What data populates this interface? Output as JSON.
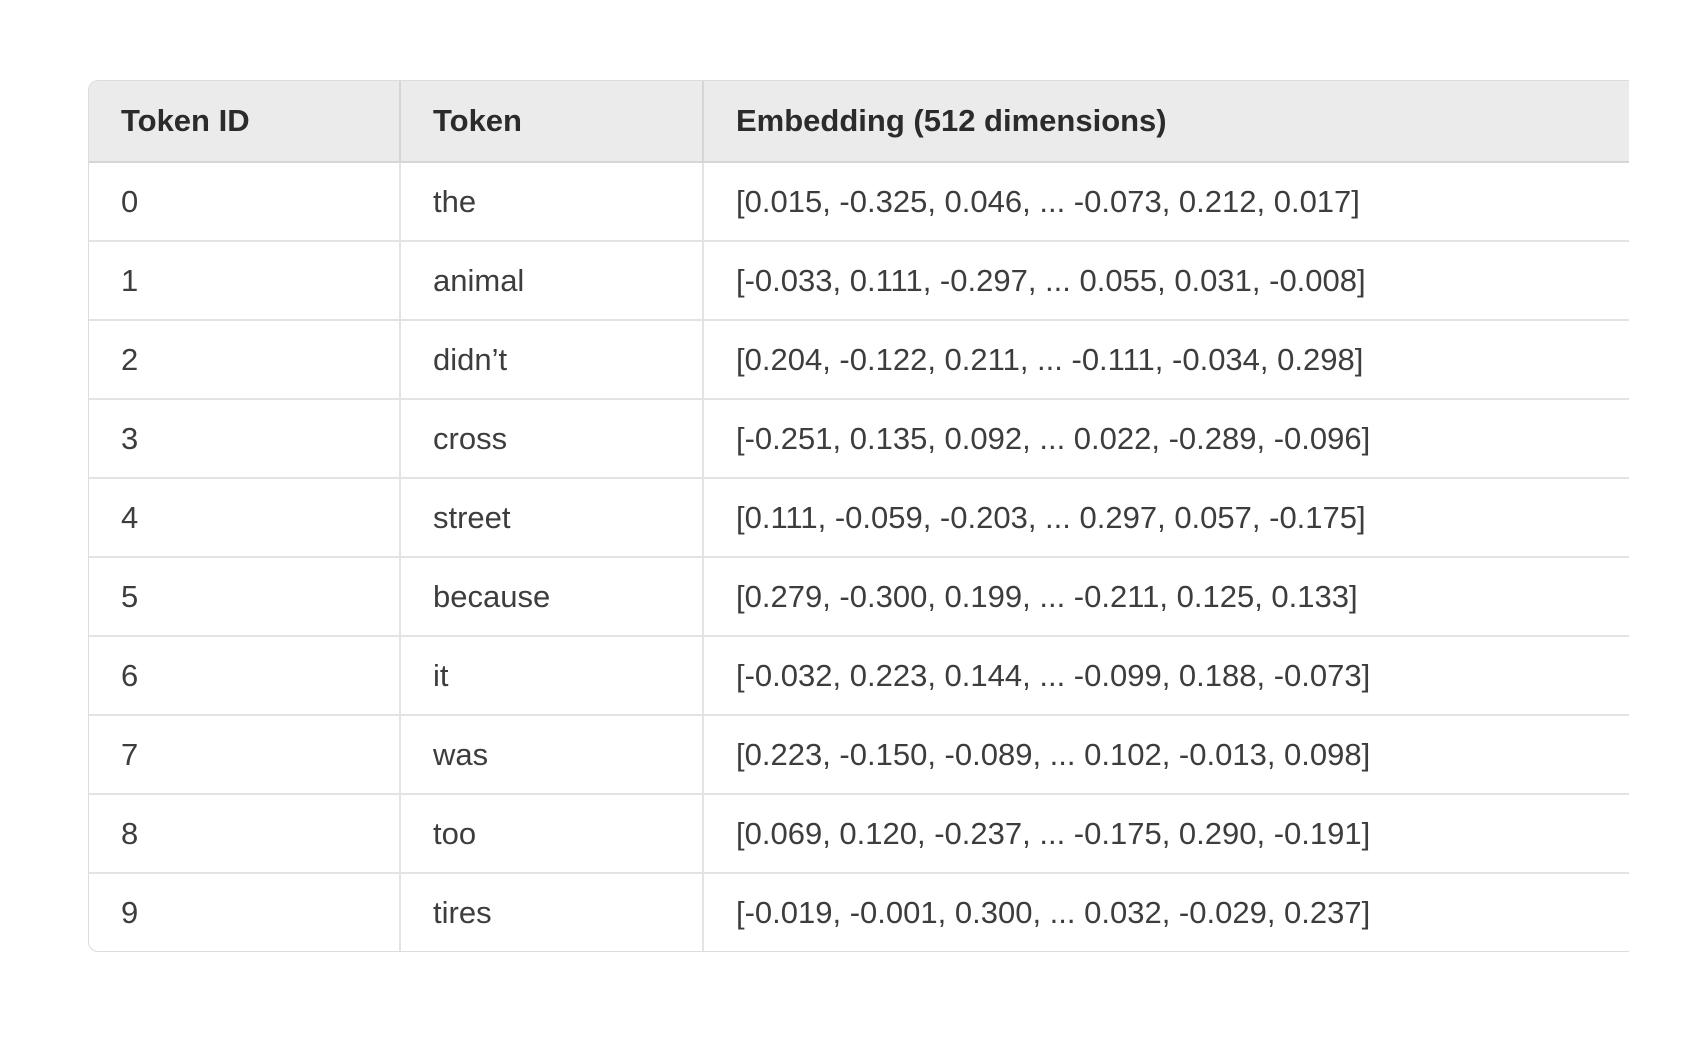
{
  "table": {
    "headers": [
      "Token ID",
      "Token",
      "Embedding (512 dimensions)"
    ],
    "rows": [
      {
        "id": "0",
        "token": "the",
        "embedding": "[0.015, -0.325, 0.046, ... -0.073, 0.212, 0.017]"
      },
      {
        "id": "1",
        "token": "animal",
        "embedding": "[-0.033, 0.111, -0.297, ... 0.055, 0.031, -0.008]"
      },
      {
        "id": "2",
        "token": "didn’t",
        "embedding": "[0.204, -0.122, 0.211, ... -0.111, -0.034, 0.298]"
      },
      {
        "id": "3",
        "token": "cross",
        "embedding": "[-0.251, 0.135, 0.092, ... 0.022, -0.289, -0.096]"
      },
      {
        "id": "4",
        "token": "street",
        "embedding": "[0.111, -0.059, -0.203, ... 0.297, 0.057, -0.175]"
      },
      {
        "id": "5",
        "token": "because",
        "embedding": "[0.279, -0.300, 0.199, ... -0.211, 0.125, 0.133]"
      },
      {
        "id": "6",
        "token": "it",
        "embedding": "[-0.032, 0.223, 0.144, ... -0.099, 0.188, -0.073]"
      },
      {
        "id": "7",
        "token": "was",
        "embedding": "[0.223, -0.150, -0.089, ... 0.102, -0.013, 0.098]"
      },
      {
        "id": "8",
        "token": "too",
        "embedding": "[0.069, 0.120, -0.237, ... -0.175, 0.290, -0.191]"
      },
      {
        "id": "9",
        "token": "tires",
        "embedding": "[-0.019, -0.001, 0.300, ... 0.032, -0.029, 0.237]"
      }
    ]
  }
}
